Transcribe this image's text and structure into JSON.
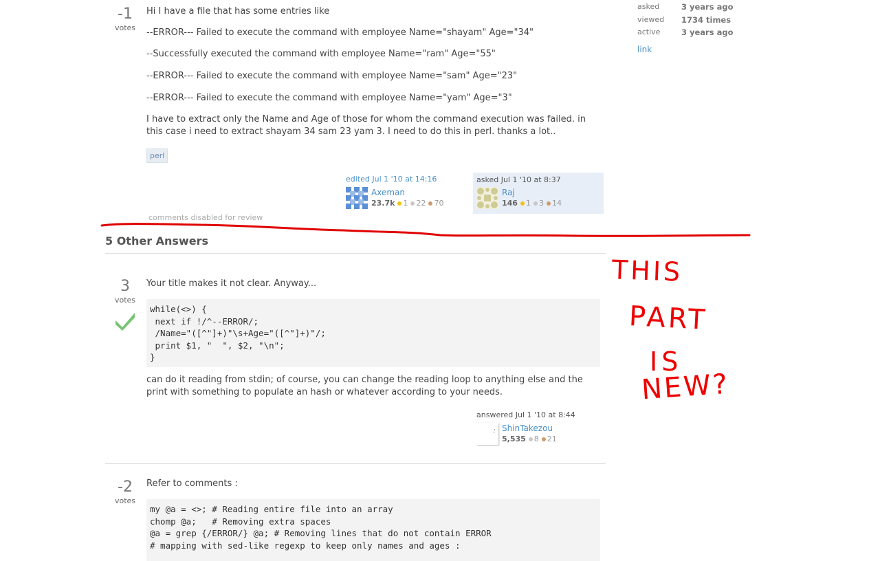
{
  "question": {
    "votes": "-1",
    "votes_label": "votes",
    "paragraphs": [
      "Hi I have a file that has some entries like",
      "--ERROR--- Failed to execute the command with employee Name=\"shayam\" Age=\"34\"",
      "--Successfully executed the command with employee Name=\"ram\" Age=\"55\"",
      "--ERROR--- Failed to execute the command with employee Name=\"sam\" Age=\"23\"",
      "--ERROR--- Failed to execute the command with employee Name=\"yam\" Age=\"3\"",
      "I have to extract only the Name and Age of those for whom the command execution was failed. in this case i need to extract shayam 34 sam 23 yam 3. I need to do this in perl. thanks a lot.."
    ],
    "tag": "perl",
    "edited": {
      "when": "edited Jul 1 '10 at 14:16",
      "user": "Axeman",
      "rep": "23.7k",
      "gold": "1",
      "silver": "22",
      "bronze": "70"
    },
    "asked": {
      "when": "asked Jul 1 '10 at 8:37",
      "user": "Raj",
      "rep": "146",
      "gold": "1",
      "silver": "3",
      "bronze": "14"
    },
    "comments_note": "comments disabled for review"
  },
  "sidebar": {
    "asked_label": "asked",
    "asked_value": "3 years ago",
    "viewed_label": "viewed",
    "viewed_value": "1734 times",
    "active_label": "active",
    "active_value": "3 years ago",
    "link": "link"
  },
  "answers_header": "5 Other Answers",
  "answers": [
    {
      "votes": "3",
      "votes_label": "votes",
      "intro": "Your title makes it not clear. Anyway...",
      "code": "while(<>) {\n next if !/^--ERROR/;\n /Name=\"([^\"]+)\"\\s+Age=\"([^\"]+)\"/;\n print $1, \"  \", $2, \"\\n\";\n}",
      "outro": "can do it reading from stdin; of course, you can change the reading loop to anything else and the print with something to populate an hash or whatever according to your needs.",
      "answered": {
        "when": "answered Jul 1 '10 at 8:44",
        "user": "ShinTakezou",
        "rep": "5,535",
        "silver": "8",
        "bronze": "21"
      }
    },
    {
      "votes": "-2",
      "votes_label": "votes",
      "intro": "Refer to comments :",
      "code": "my @a = <>; # Reading entire file into an array\nchomp @a;   # Removing extra spaces\n@a = grep {/ERROR/} @a; # Removing lines that do not contain ERROR\n# mapping with sed-like regexp to keep only names and ages :"
    }
  ],
  "annotation": {
    "lines": [
      "THIS",
      "PART",
      "IS",
      "NEW?"
    ],
    "color": "#e00000"
  }
}
